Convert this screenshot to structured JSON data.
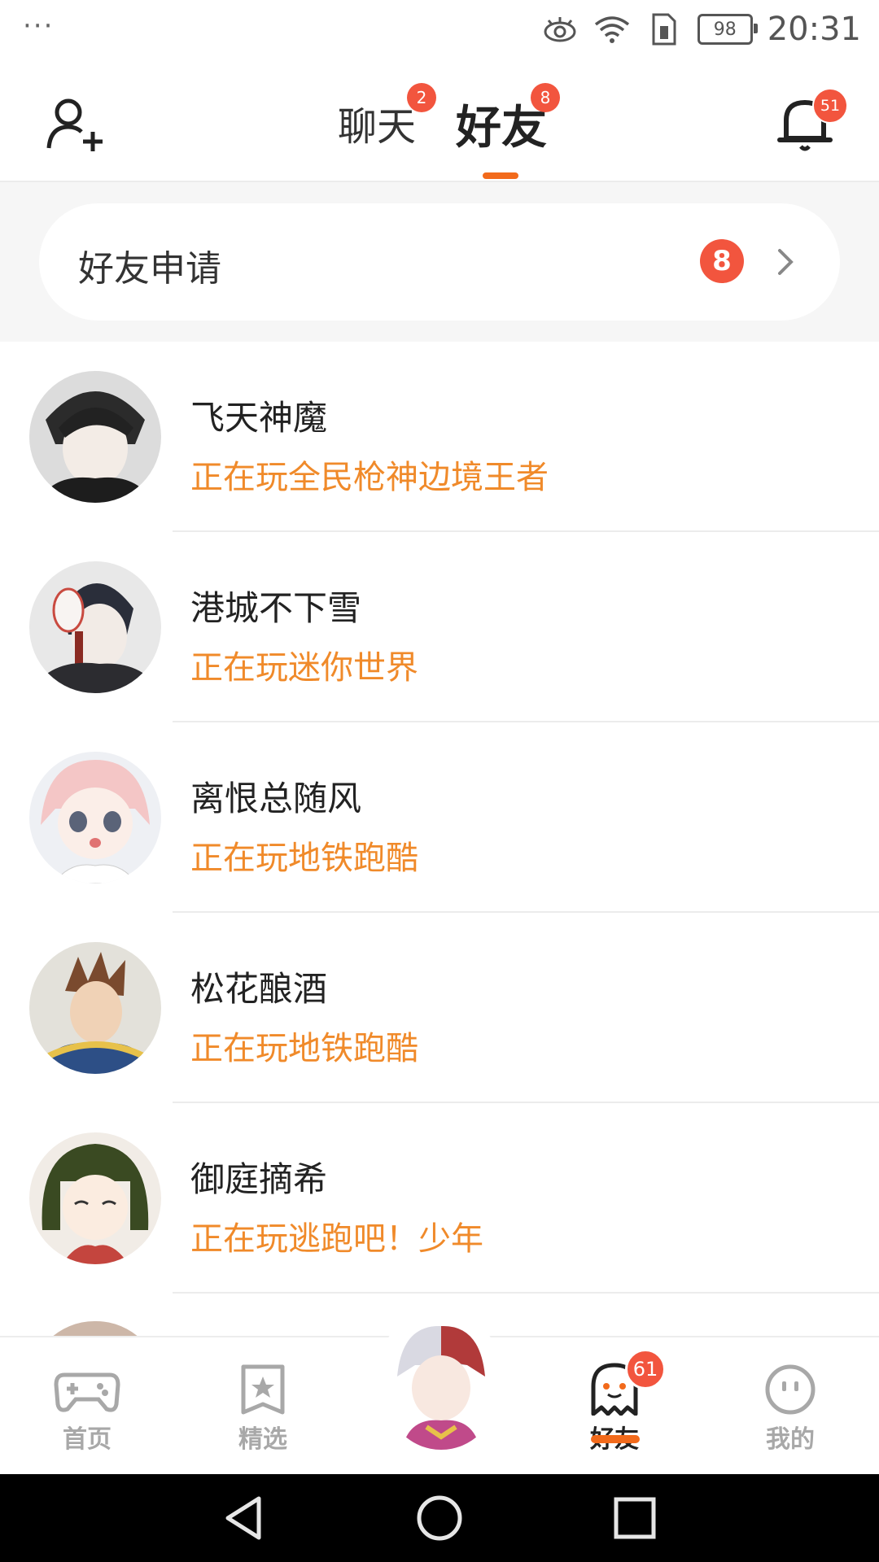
{
  "status_bar": {
    "more": "···",
    "battery": "98",
    "time": "20:31",
    "icons": [
      "eye-icon",
      "wifi-icon",
      "sim-icon",
      "battery-icon"
    ]
  },
  "header": {
    "tabs": [
      {
        "label": "聊天",
        "badge": "2"
      },
      {
        "label": "好友",
        "badge": "8",
        "active": true
      }
    ],
    "bell_badge": "51",
    "accent_color": "#f26a1b"
  },
  "friend_request": {
    "label": "好友申请",
    "count": "8"
  },
  "friends": [
    {
      "name": "飞天神魔",
      "status": "正在玩全民枪神边境王者"
    },
    {
      "name": "港城不下雪",
      "status": "正在玩迷你世界"
    },
    {
      "name": "离恨总随风",
      "status": "正在玩地铁跑酷"
    },
    {
      "name": "松花酿酒",
      "status": "正在玩地铁跑酷"
    },
    {
      "name": "御庭摘希",
      "status": "正在玩逃跑吧！少年"
    }
  ],
  "bottom_nav": {
    "items": [
      {
        "label": "首页",
        "icon": "gamepad-icon"
      },
      {
        "label": "精选",
        "icon": "star-card-icon"
      },
      {
        "label": "",
        "icon": "center-avatar"
      },
      {
        "label": "好友",
        "icon": "ghost-icon",
        "badge": "61",
        "active": true
      },
      {
        "label": "我的",
        "icon": "smile-face-icon"
      }
    ]
  },
  "system_nav": [
    "back-icon",
    "home-icon",
    "recents-icon"
  ]
}
